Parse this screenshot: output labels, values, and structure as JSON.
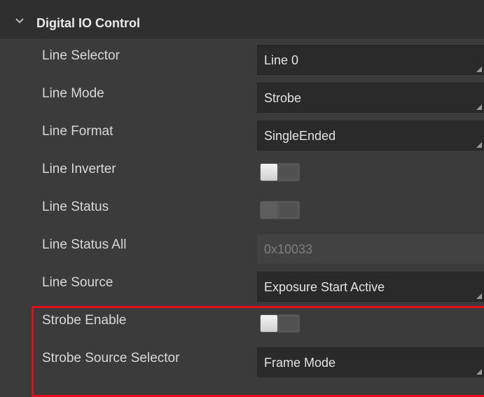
{
  "section": {
    "title": "Digital IO Control",
    "expanded": true
  },
  "rows": [
    {
      "label": "Line Selector",
      "value": "Line 0"
    },
    {
      "label": "Line Mode",
      "value": "Strobe"
    },
    {
      "label": "Line Format",
      "value": "SingleEnded"
    },
    {
      "label": "Line Inverter",
      "toggle": "off"
    },
    {
      "label": "Line Status",
      "toggle": "off",
      "disabled": true
    },
    {
      "label": "Line Status All",
      "value": "0x10033",
      "disabled": true
    },
    {
      "label": "Line Source",
      "value": "Exposure Start Active"
    },
    {
      "label": "Strobe Enable",
      "toggle": "off"
    },
    {
      "label": "Strobe Source Selector",
      "value": "Frame Mode"
    }
  ],
  "highlight": {
    "color": "#e0101a"
  },
  "icons": {
    "section_toggle": "chevron-down-icon",
    "dropdown": "dropdown-corner-icon"
  }
}
